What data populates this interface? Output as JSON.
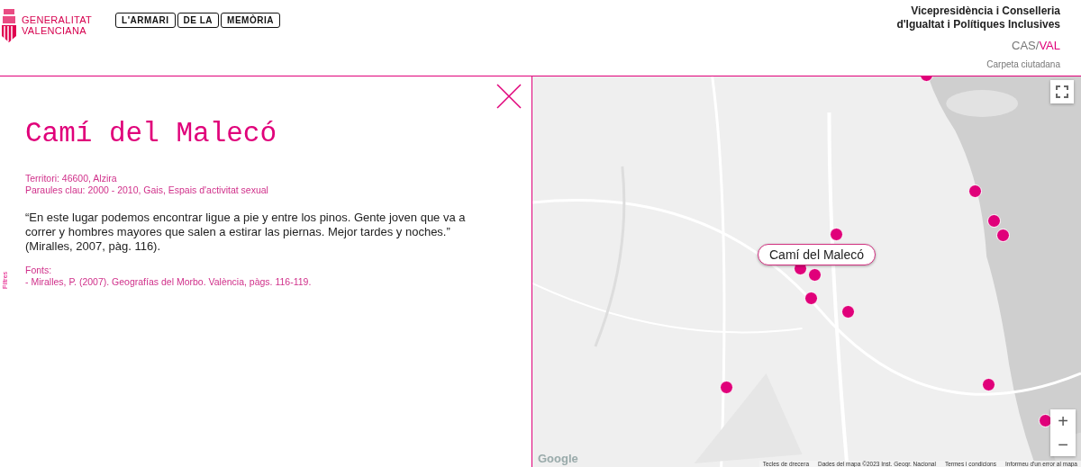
{
  "header": {
    "logo_gva": [
      "GENERALITAT",
      "VALENCIANA"
    ],
    "logo_armari": [
      "L'ARMARI",
      "DE LA",
      "MEMÒRIA"
    ],
    "ministry": [
      "Vicepresidència i Conselleria",
      "d'Igualtat i Polítiques Inclusives"
    ],
    "languages": [
      {
        "label": "CAS",
        "selected": false
      },
      {
        "label": "VAL",
        "selected": true
      }
    ],
    "lang_separator": "/",
    "citizen_link": "Carpeta ciutadana"
  },
  "sidebar": {
    "filters_tab": "Filtres"
  },
  "detail": {
    "title": "Camí del Malecó",
    "meta": [
      "Territori: 46600, Alzira",
      "Paraules clau: 2000 - 2010, Gais, Espais d'activitat sexual"
    ],
    "quote": "“En este lugar podemos encontrar ligue a pie y entre los pinos. Gente joven que va a correr y hombres mayores que salen a estirar las piernas. Mejor tardes y noches.” (Miralles, 2007, pàg. 116).",
    "sources_label": "Fonts:",
    "sources": [
      "- Miralles, P. (2007). Geografías del Morbo. València, pàgs. 116-119."
    ]
  },
  "map": {
    "marker_label": "Camí del Malecó",
    "zoom_in": "+",
    "zoom_out": "−",
    "logo": "Google",
    "footer": [
      "Tecles de drecera",
      "Dades del mapa ©2023 Inst. Geogr. Nacional",
      "Termes i condicions",
      "Informeu d'un error al mapa"
    ]
  }
}
